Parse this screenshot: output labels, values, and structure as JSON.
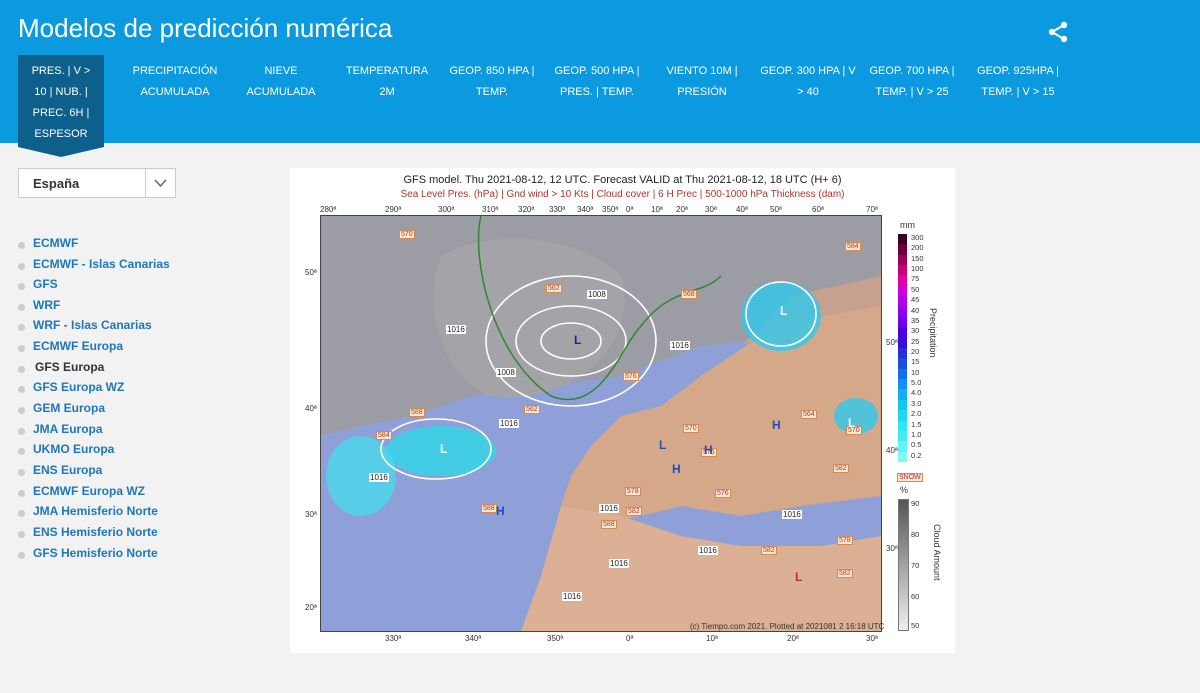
{
  "page": {
    "title": "Modelos de predicción numérica"
  },
  "tabs": [
    {
      "label": "PRES. | V > 10 | NUB. | PREC. 6H | ESPESOR",
      "active": true
    },
    {
      "label": "PRECIPITACIÓN ACUMULADA"
    },
    {
      "label": "NIEVE ACUMULADA"
    },
    {
      "label": "TEMPERATURA 2M"
    },
    {
      "label": "GEOP. 850 HPA | TEMP."
    },
    {
      "label": "GEOP. 500 HPA | PRES. | TEMP."
    },
    {
      "label": "VIENTO 10M | PRESIÓN"
    },
    {
      "label": "GEOP. 300 HPA | V > 40"
    },
    {
      "label": "GEOP. 700 HPA | TEMP. | V > 25"
    },
    {
      "label": "GEOP. 925HPA | TEMP. | V > 15"
    }
  ],
  "region": {
    "selected": "España"
  },
  "models": [
    {
      "label": "ECMWF"
    },
    {
      "label": "ECMWF - Islas Canarias"
    },
    {
      "label": "GFS"
    },
    {
      "label": "WRF"
    },
    {
      "label": "WRF - Islas Canarias"
    },
    {
      "label": "ECMWF Europa"
    },
    {
      "label": "GFS Europa",
      "active": true
    },
    {
      "label": "GFS Europa WZ"
    },
    {
      "label": "GEM Europa"
    },
    {
      "label": "JMA Europa"
    },
    {
      "label": "UKMO Europa"
    },
    {
      "label": "ENS Europa"
    },
    {
      "label": "ECMWF Europa WZ"
    },
    {
      "label": "JMA Hemisferio Norte"
    },
    {
      "label": "ENS Hemisferio Norte"
    },
    {
      "label": "GFS Hemisferio Norte"
    }
  ],
  "map": {
    "title": "GFS model. Thu 2021-08-12, 12 UTC. Forecast VALID at Thu 2021-08-12, 18 UTC (H+ 6)",
    "subtitle": "Sea Level Pres. (hPa) | Gnd wind > 10 Kts | Cloud cover | 6 H Prec | 500-1000 hPa Thickness (dam)",
    "credit": "(c) Tiempo.com 2021. Plotted at 2021081 2 16:18 UTC",
    "top_lon_ticks": [
      "280ª",
      "290ª",
      "300ª",
      "310ª",
      "320ª",
      "330ª",
      "340ª",
      "350ª",
      "0ª",
      "10ª",
      "20ª",
      "30ª",
      "40ª",
      "50ª",
      "60ª",
      "70ª"
    ],
    "bottom_lon_ticks": [
      "330ª",
      "340ª",
      "350ª",
      "0ª",
      "10ª",
      "20ª",
      "30ª"
    ],
    "left_lat_ticks": [
      "50ª",
      "40ª",
      "30ª",
      "20ª"
    ],
    "right_lat_ticks": [
      "50ª",
      "40ª",
      "30ª"
    ],
    "isobar_labels": [
      "1016",
      "1008",
      "1008",
      "1016",
      "1016",
      "1016",
      "1016",
      "1016",
      "1016",
      "1016",
      "1016"
    ],
    "thickness_labels": [
      "570",
      "562",
      "562",
      "588",
      "584",
      "568",
      "576",
      "564",
      "570",
      "588",
      "576",
      "578",
      "582",
      "588",
      "576",
      "582",
      "582",
      "578",
      "584",
      "570",
      "582"
    ],
    "pressure_centers": [
      "L",
      "L",
      "L",
      "L",
      "H",
      "H",
      "H",
      "H",
      "L",
      "L"
    ]
  },
  "precip_bar": {
    "unit": "mm",
    "title": "Precipitation",
    "labels": [
      "300",
      "200",
      "150",
      "100",
      "75",
      "50",
      "45",
      "40",
      "35",
      "30",
      "25",
      "20",
      "15",
      "10",
      "5.0",
      "4.0",
      "3.0",
      "2.0",
      "1.5",
      "1.0",
      "0.5",
      "0.2"
    ],
    "colors": [
      "#3a0020",
      "#6b003a",
      "#99005a",
      "#c4007a",
      "#e000a0",
      "#d000d8",
      "#b000e8",
      "#9000f0",
      "#7000f0",
      "#5000e0",
      "#3a10d8",
      "#2a30d8",
      "#1a50e0",
      "#1070e8",
      "#1090f0",
      "#10b0f0",
      "#10c8f0",
      "#20d8f0",
      "#30e4f0",
      "#40eef0",
      "#60f4f4",
      "#80f8f8"
    ],
    "snow_label": "SNOW"
  },
  "cloud_bar": {
    "unit": "%",
    "title": "Cloud Amount",
    "labels": [
      "90",
      "80",
      "70",
      "60",
      "50"
    ]
  }
}
